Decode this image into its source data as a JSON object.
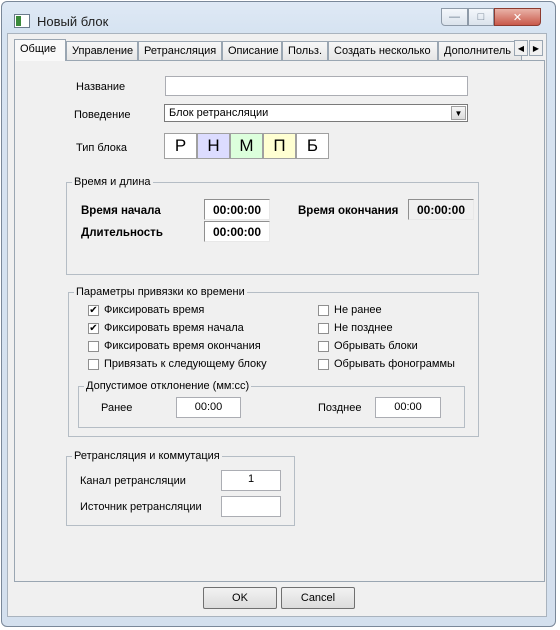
{
  "window": {
    "title": "Новый блок"
  },
  "tabs": [
    "Общие",
    "Управление",
    "Ретрансляция",
    "Описание",
    "Польз.",
    "Создать несколько",
    "Дополнитель"
  ],
  "form": {
    "name_label": "Название",
    "name_value": "",
    "behavior_label": "Поведение",
    "behavior_value": "Блок ретрансляции",
    "type_label": "Тип блока",
    "types": [
      {
        "letter": "Р",
        "color": "#ffffff"
      },
      {
        "letter": "Н",
        "color": "#dcdcff"
      },
      {
        "letter": "М",
        "color": "#dcffdc"
      },
      {
        "letter": "П",
        "color": "#ffffd2"
      },
      {
        "letter": "Б",
        "color": "#ffffff"
      }
    ]
  },
  "time_group": {
    "title": "Время и длина",
    "start_label": "Время начала",
    "start_value": "00:00:00",
    "duration_label": "Длительность",
    "duration_value": "00:00:00",
    "end_label": "Время окончания",
    "end_value": "00:00:00"
  },
  "binding_group": {
    "title": "Параметры привязки ко времени",
    "left_checks": [
      {
        "label": "Фиксировать время",
        "checked": true
      },
      {
        "label": "Фиксировать время начала",
        "checked": true
      },
      {
        "label": "Фиксировать время окончания",
        "checked": false
      },
      {
        "label": "Привязать к следующему блоку",
        "checked": false
      }
    ],
    "right_checks": [
      {
        "label": "Не ранее",
        "checked": false
      },
      {
        "label": "Не позднее",
        "checked": false
      },
      {
        "label": "Обрывать блоки",
        "checked": false
      },
      {
        "label": "Обрывать фонограммы",
        "checked": false
      }
    ],
    "deviation": {
      "title": "Допустимое отклонение (мм:сс)",
      "early_label": "Ранее",
      "early_value": "00:00",
      "late_label": "Позднее",
      "late_value": "00:00"
    }
  },
  "relay_group": {
    "title": "Ретрансляция и коммутация",
    "channel_label": "Канал ретрансляции",
    "channel_value": "1",
    "source_label": "Источник ретрансляции",
    "source_value": ""
  },
  "buttons": {
    "ok": "OK",
    "cancel": "Cancel"
  }
}
